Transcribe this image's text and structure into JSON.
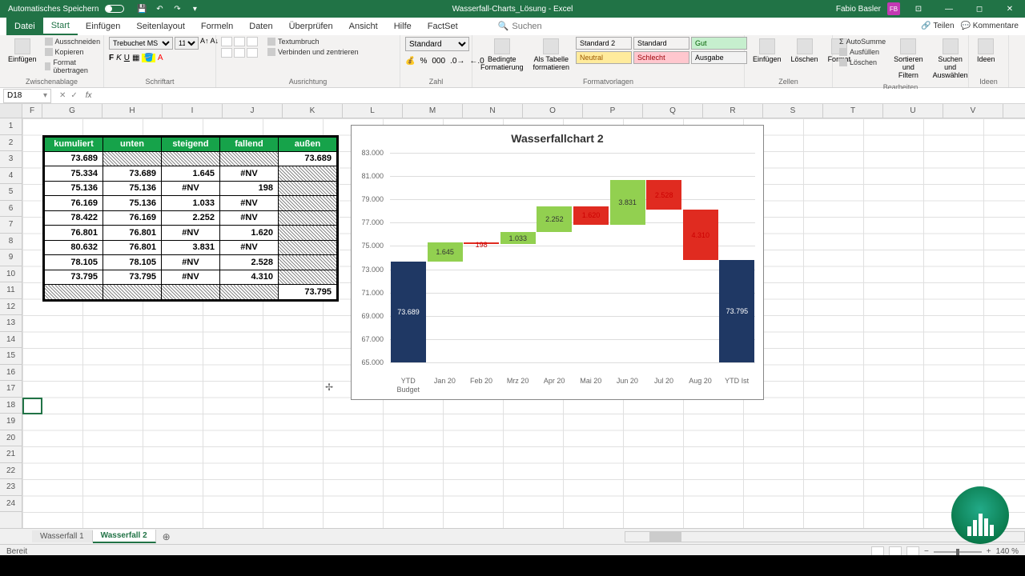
{
  "titlebar": {
    "autosave": "Automatisches Speichern",
    "doc_title": "Wasserfall-Charts_Lösung - Excel",
    "user": "Fabio Basler",
    "user_initials": "FB"
  },
  "tabs": {
    "file": "Datei",
    "start": "Start",
    "insert": "Einfügen",
    "layout": "Seitenlayout",
    "formulas": "Formeln",
    "data": "Daten",
    "review": "Überprüfen",
    "view": "Ansicht",
    "help": "Hilfe",
    "factset": "FactSet",
    "search": "Suchen",
    "share": "Teilen",
    "comments": "Kommentare"
  },
  "ribbon": {
    "clipboard": {
      "paste": "Einfügen",
      "cut": "Ausschneiden",
      "copy": "Kopieren",
      "format": "Format übertragen",
      "label": "Zwischenablage"
    },
    "font": {
      "name": "Trebuchet MS",
      "size": "11",
      "label": "Schriftart"
    },
    "align": {
      "wrap": "Textumbruch",
      "merge": "Verbinden und zentrieren",
      "label": "Ausrichtung"
    },
    "number": {
      "format": "Standard",
      "label": "Zahl"
    },
    "styles": {
      "cond": "Bedingte Formatierung",
      "table": "Als Tabelle formatieren",
      "s1": "Standard 2",
      "s2": "Standard",
      "s3": "Gut",
      "s4": "Neutral",
      "s5": "Schlecht",
      "s6": "Ausgabe",
      "label": "Formatvorlagen"
    },
    "cells": {
      "insert": "Einfügen",
      "delete": "Löschen",
      "format": "Format",
      "label": "Zellen"
    },
    "editing": {
      "sum": "AutoSumme",
      "fill": "Ausfüllen",
      "clear": "Löschen",
      "sort": "Sortieren und Filtern",
      "find": "Suchen und Auswählen",
      "label": "Bearbeiten"
    },
    "ideas": {
      "label": "Ideen"
    }
  },
  "formula_bar": {
    "cell_ref": "D18",
    "formula": ""
  },
  "columns": [
    "F",
    "G",
    "H",
    "I",
    "J",
    "K",
    "L",
    "M",
    "N",
    "O",
    "P",
    "Q",
    "R",
    "S",
    "T",
    "U",
    "V"
  ],
  "rows": [
    "1",
    "2",
    "3",
    "4",
    "5",
    "6",
    "7",
    "8",
    "9",
    "10",
    "11",
    "12",
    "13",
    "14",
    "15",
    "16",
    "17",
    "18",
    "19",
    "20",
    "21",
    "22",
    "23",
    "24"
  ],
  "table": {
    "headers": [
      "kumuliert",
      "unten",
      "steigend",
      "fallend",
      "außen"
    ],
    "rows": [
      {
        "kum": "73.689",
        "unten": "hatch",
        "steig": "hatch",
        "fall": "hatch",
        "aussen": "73.689"
      },
      {
        "kum": "75.334",
        "unten": "73.689",
        "steig": "1.645",
        "fall": "#NV",
        "aussen": "hatch"
      },
      {
        "kum": "75.136",
        "unten": "75.136",
        "steig": "#NV",
        "fall": "198",
        "aussen": "hatch"
      },
      {
        "kum": "76.169",
        "unten": "75.136",
        "steig": "1.033",
        "fall": "#NV",
        "aussen": "hatch"
      },
      {
        "kum": "78.422",
        "unten": "76.169",
        "steig": "2.252",
        "fall": "#NV",
        "aussen": "hatch"
      },
      {
        "kum": "76.801",
        "unten": "76.801",
        "steig": "#NV",
        "fall": "1.620",
        "aussen": "hatch"
      },
      {
        "kum": "80.632",
        "unten": "76.801",
        "steig": "3.831",
        "fall": "#NV",
        "aussen": "hatch"
      },
      {
        "kum": "78.105",
        "unten": "78.105",
        "steig": "#NV",
        "fall": "2.528",
        "aussen": "hatch"
      },
      {
        "kum": "73.795",
        "unten": "73.795",
        "steig": "#NV",
        "fall": "4.310",
        "aussen": "hatch"
      },
      {
        "kum": "hatch",
        "unten": "hatch",
        "steig": "hatch",
        "fall": "hatch",
        "aussen": "73.795"
      }
    ]
  },
  "chart_data": {
    "type": "bar",
    "title": "Wasserfallchart 2",
    "ylabel": "",
    "xlabel": "",
    "ylim": [
      65000,
      83000
    ],
    "y_ticks": [
      "83.000",
      "81.000",
      "79.000",
      "77.000",
      "75.000",
      "73.000",
      "71.000",
      "69.000",
      "67.000",
      "65.000"
    ],
    "categories": [
      "YTD Budget",
      "Jan 20",
      "Feb 20",
      "Mrz 20",
      "Apr 20",
      "Mai 20",
      "Jun 20",
      "Jul 20",
      "Aug 20",
      "YTD Ist"
    ],
    "series": [
      {
        "name": "unten",
        "role": "invisible",
        "values": [
          0,
          73689,
          75136,
          75136,
          76169,
          76801,
          76801,
          78105,
          73795,
          0
        ]
      },
      {
        "name": "steigend",
        "color": "#70ad47",
        "values": [
          null,
          1645,
          null,
          1033,
          2252,
          null,
          3831,
          null,
          null,
          null
        ]
      },
      {
        "name": "fallend",
        "color": "#e02b20",
        "values": [
          null,
          null,
          198,
          null,
          null,
          1620,
          null,
          2528,
          4310,
          null
        ]
      },
      {
        "name": "außen",
        "color": "#1f3864",
        "values": [
          73689,
          null,
          null,
          null,
          null,
          null,
          null,
          null,
          null,
          73795
        ]
      }
    ],
    "data_labels": [
      "73.689",
      "1.645",
      "198",
      "1.033",
      "2.252",
      "1.620",
      "3.831",
      "2.528",
      "4.310",
      "73.795"
    ]
  },
  "sheet_tabs": {
    "tab1": "Wasserfall 1",
    "tab2": "Wasserfall 2"
  },
  "status": {
    "ready": "Bereit",
    "zoom": "140 %"
  }
}
